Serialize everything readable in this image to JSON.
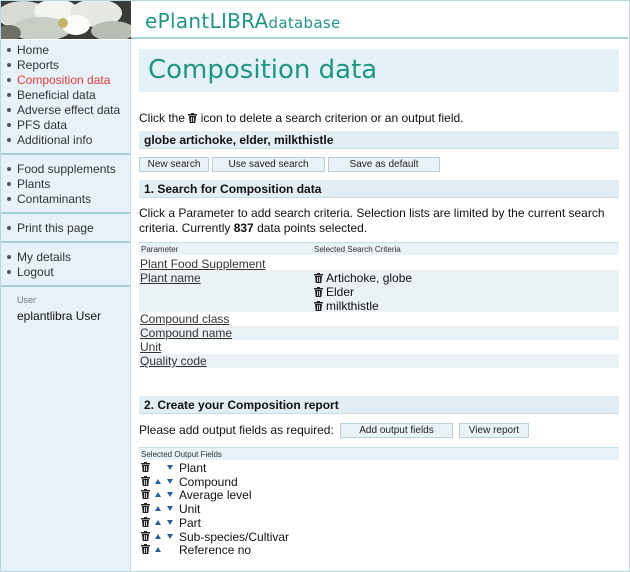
{
  "brand": {
    "prefix": "ePlant",
    "middle": "LIBRA",
    "suffix": "database"
  },
  "sidebar": {
    "group1": [
      {
        "label": "Home",
        "active": false
      },
      {
        "label": "Reports",
        "active": false
      },
      {
        "label": "Composition data",
        "active": true
      },
      {
        "label": "Beneficial data",
        "active": false
      },
      {
        "label": "Adverse effect data",
        "active": false
      },
      {
        "label": "PFS data",
        "active": false
      },
      {
        "label": "Additional info",
        "active": false
      }
    ],
    "group2": [
      {
        "label": "Food supplements"
      },
      {
        "label": "Plants"
      },
      {
        "label": "Contaminants"
      }
    ],
    "group3": [
      {
        "label": "Print this page"
      }
    ],
    "group4": [
      {
        "label": "My details"
      },
      {
        "label": "Logout"
      }
    ],
    "user_caption": "User",
    "user_name": "eplantlibra User"
  },
  "main": {
    "title": "Composition data",
    "instruction_pre": "Click the",
    "instruction_post": "icon to delete a search criterion or an output field.",
    "search_summary": "globe artichoke, elder, milkthistle",
    "buttons": {
      "new_search": "New search",
      "use_saved": "Use saved search",
      "save_default": "Save as default"
    },
    "section1_title": "1. Search for Composition data",
    "section1_text_pre": "Click a Parameter to add search criteria. Selection lists are limited by the current search criteria. Currently",
    "data_points": "837",
    "section1_text_post": "data points selected.",
    "param_header": "Parameter",
    "criteria_header": "Selected Search Criteria",
    "params": [
      {
        "label": "Plant Food Supplement",
        "criteria": []
      },
      {
        "label": "Plant name",
        "criteria": [
          "Artichoke, globe",
          "Elder",
          "milkthistle"
        ]
      },
      {
        "label": "Compound class",
        "criteria": []
      },
      {
        "label": "Compound name",
        "criteria": []
      },
      {
        "label": "Unit",
        "criteria": []
      },
      {
        "label": "Quality code",
        "criteria": []
      }
    ],
    "section2_title": "2. Create your Composition report",
    "add_prompt": "Please add output fields as required:",
    "add_button": "Add output fields",
    "view_button": "View report",
    "output_header": "Selected Output Fields",
    "output_fields": [
      "Plant",
      "Compound",
      "Average level",
      "Unit",
      "Part",
      "Sub-species/Cultivar",
      "Reference no"
    ]
  },
  "icons": {
    "delete": "trash-icon",
    "move_up": "arrow-up-icon",
    "move_down": "arrow-down-icon"
  },
  "colors": {
    "accent": "#1f9585",
    "active_nav": "#e23b3b",
    "panel": "#e4f1f7"
  }
}
